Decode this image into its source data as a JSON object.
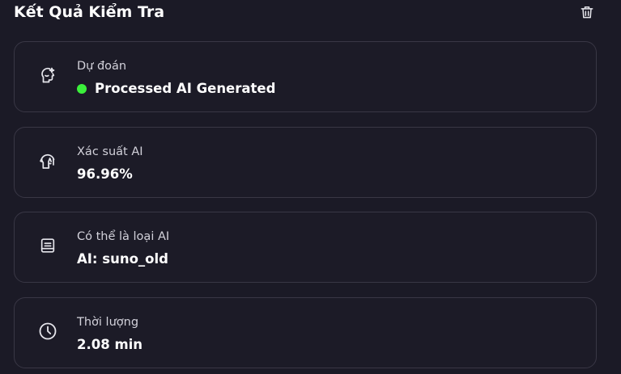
{
  "header": {
    "title": "Kết Quả Kiểm Tra",
    "delete_icon": "trash-icon"
  },
  "results": [
    {
      "label": "Dự đoán",
      "value": "Processed AI Generated",
      "icon": "sparkle-head-icon",
      "status_color": "#3bf03b"
    },
    {
      "label": "Xác suất AI",
      "value": "96.96%",
      "icon": "ai-head-icon"
    },
    {
      "label": "Có thể là loại AI",
      "value": "AI: suno_old",
      "icon": "document-list-icon"
    },
    {
      "label": "Thời lượng",
      "value": "2.08 min",
      "icon": "clock-icon"
    }
  ],
  "colors": {
    "background": "#1b1a26",
    "card_border": "#393745",
    "status_green": "#3bf03b"
  }
}
